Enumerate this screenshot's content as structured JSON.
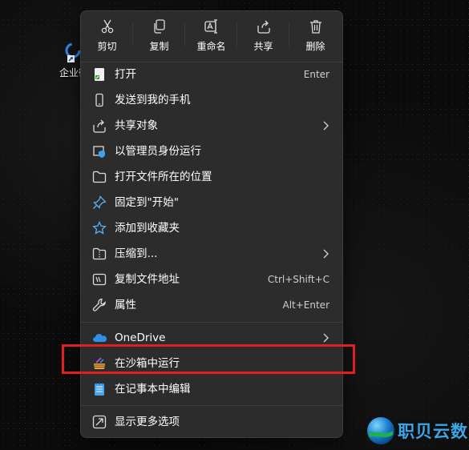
{
  "desktop": {
    "icon_label": "企业微"
  },
  "quick_actions": [
    {
      "label": "剪切",
      "icon": "scissors-icon"
    },
    {
      "label": "复制",
      "icon": "copy-icon"
    },
    {
      "label": "重命名",
      "icon": "rename-icon"
    },
    {
      "label": "共享",
      "icon": "share-icon"
    },
    {
      "label": "删除",
      "icon": "trash-icon"
    }
  ],
  "menu_items": [
    {
      "label": "打开",
      "accelerator": "Enter",
      "icon": "app-shortcut-icon"
    },
    {
      "label": "发送到我的手机",
      "icon": "phone-icon"
    },
    {
      "label": "共享对象",
      "icon": "share-icon",
      "submenu": true
    },
    {
      "label": "以管理员身份运行",
      "icon": "shield-admin-icon"
    },
    {
      "label": "打开文件所在的位置",
      "icon": "folder-icon"
    },
    {
      "label": "固定到\"开始\"",
      "icon": "pin-icon"
    },
    {
      "label": "添加到收藏夹",
      "icon": "star-icon"
    },
    {
      "label": "压缩到...",
      "icon": "zip-folder-icon",
      "submenu": true
    },
    {
      "label": "复制文件地址",
      "accelerator": "Ctrl+Shift+C",
      "icon": "copy-path-icon"
    },
    {
      "label": "属性",
      "accelerator": "Alt+Enter",
      "icon": "wrench-icon"
    },
    {
      "label": "OneDrive",
      "icon": "onedrive-cloud-icon",
      "submenu": true
    },
    {
      "label": "在沙箱中运行",
      "icon": "sandbox-icon",
      "highlighted": true
    },
    {
      "label": "在记事本中编辑",
      "icon": "notepad-icon"
    },
    {
      "label": "显示更多选项",
      "icon": "more-options-icon"
    }
  ],
  "watermark": {
    "text": "职贝云数"
  },
  "colors": {
    "menu_bg": "#2c2c2c",
    "highlight_border": "#e02020",
    "onedrive_blue": "#2f8ee8",
    "watermark_blue": "#3aa7e8"
  }
}
